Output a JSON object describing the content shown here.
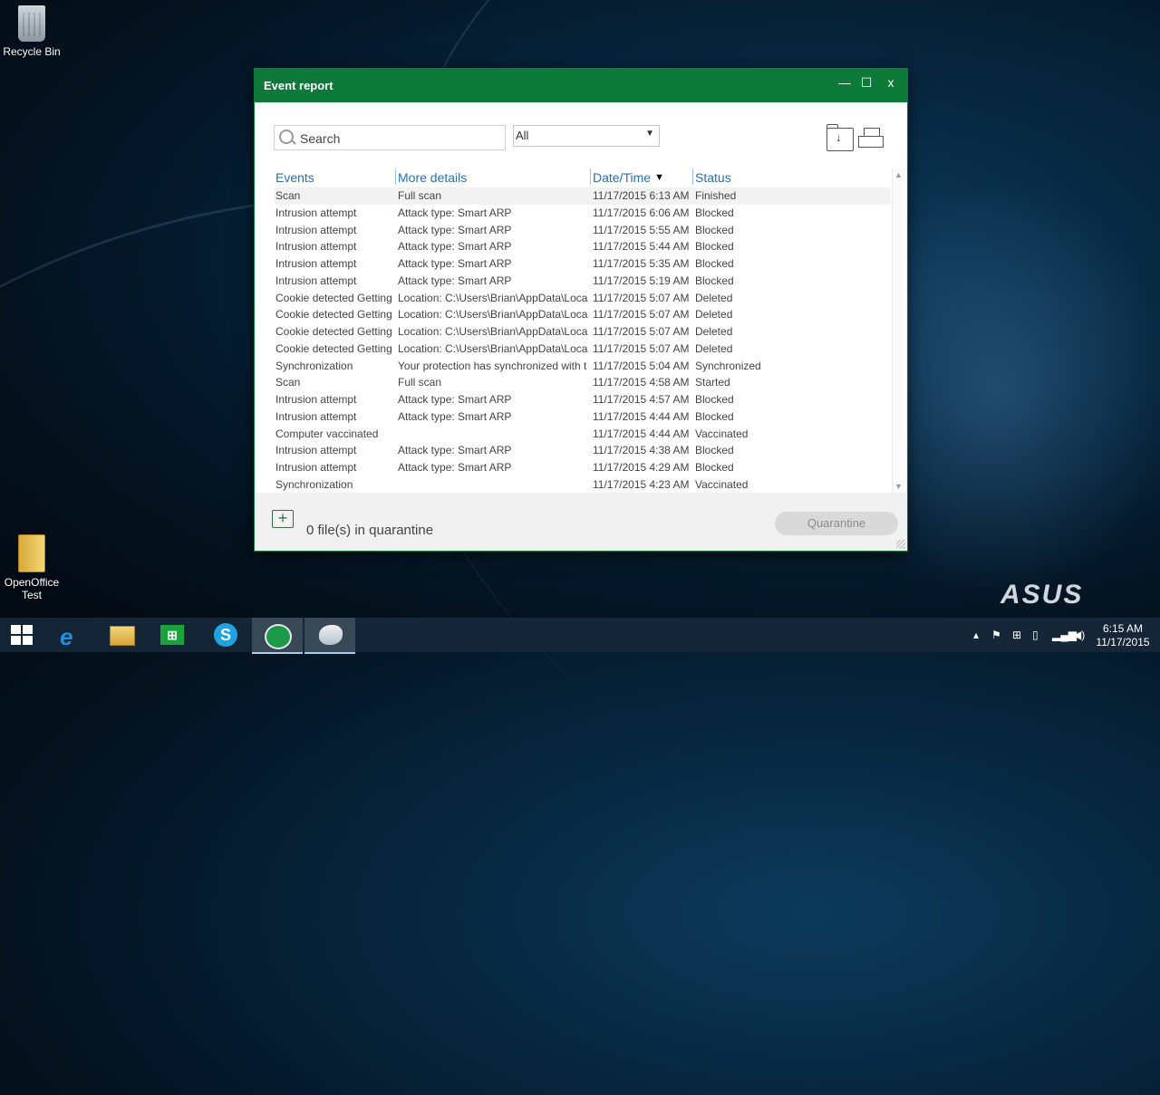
{
  "desktop": {
    "icons": [
      {
        "label": "Recycle Bin"
      },
      {
        "label": "OpenOffice Test"
      }
    ],
    "brand": "ASUS"
  },
  "window": {
    "title": "Event report",
    "controls": {
      "minimize": "—",
      "maximize": "☐",
      "close": "x"
    }
  },
  "toolbar": {
    "search_placeholder": "Search",
    "filter_value": "All"
  },
  "table": {
    "columns": [
      "Events",
      "More details",
      "Date/Time",
      "Status"
    ],
    "rows": [
      {
        "event": "Scan",
        "details": "Full scan",
        "datetime": "11/17/2015 6:13 AM",
        "status": "Finished"
      },
      {
        "event": "Intrusion attempt",
        "details": "Attack type: Smart ARP",
        "datetime": "11/17/2015 6:06 AM",
        "status": "Blocked"
      },
      {
        "event": "Intrusion attempt",
        "details": "Attack type: Smart ARP",
        "datetime": "11/17/2015 5:55 AM",
        "status": "Blocked"
      },
      {
        "event": "Intrusion attempt",
        "details": "Attack type: Smart ARP",
        "datetime": "11/17/2015 5:44 AM",
        "status": "Blocked"
      },
      {
        "event": "Intrusion attempt",
        "details": "Attack type: Smart ARP",
        "datetime": "11/17/2015 5:35 AM",
        "status": "Blocked"
      },
      {
        "event": "Intrusion attempt",
        "details": "Attack type: Smart ARP",
        "datetime": "11/17/2015 5:19 AM",
        "status": "Blocked"
      },
      {
        "event": "Cookie detected Getting",
        "details": "Location: C:\\Users\\Brian\\AppData\\Loca",
        "datetime": "11/17/2015 5:07 AM",
        "status": "Deleted"
      },
      {
        "event": "Cookie detected Getting",
        "details": "Location: C:\\Users\\Brian\\AppData\\Loca",
        "datetime": "11/17/2015 5:07 AM",
        "status": "Deleted"
      },
      {
        "event": "Cookie detected Getting",
        "details": "Location: C:\\Users\\Brian\\AppData\\Loca",
        "datetime": "11/17/2015 5:07 AM",
        "status": "Deleted"
      },
      {
        "event": "Cookie detected Getting",
        "details": "Location: C:\\Users\\Brian\\AppData\\Loca",
        "datetime": "11/17/2015 5:07 AM",
        "status": "Deleted"
      },
      {
        "event": "Synchronization",
        "details": "Your protection has synchronized with t",
        "datetime": "11/17/2015 5:04 AM",
        "status": "Synchronized"
      },
      {
        "event": "Scan",
        "details": "Full scan",
        "datetime": "11/17/2015 4:58 AM",
        "status": "Started"
      },
      {
        "event": "Intrusion attempt",
        "details": "Attack type: Smart ARP",
        "datetime": "11/17/2015 4:57 AM",
        "status": "Blocked"
      },
      {
        "event": "Intrusion attempt",
        "details": "Attack type: Smart ARP",
        "datetime": "11/17/2015 4:44 AM",
        "status": "Blocked"
      },
      {
        "event": "Computer vaccinated",
        "details": "",
        "datetime": "11/17/2015 4:44 AM",
        "status": "Vaccinated"
      },
      {
        "event": "Intrusion attempt",
        "details": "Attack type: Smart ARP",
        "datetime": "11/17/2015 4:38 AM",
        "status": "Blocked"
      },
      {
        "event": "Intrusion attempt",
        "details": "Attack type: Smart ARP",
        "datetime": "11/17/2015 4:29 AM",
        "status": "Blocked"
      },
      {
        "event": "Synchronization",
        "details": "",
        "datetime": "11/17/2015 4:23 AM",
        "status": "Vaccinated"
      }
    ]
  },
  "footer": {
    "quarantine_text": "0 file(s) in quarantine",
    "quarantine_button": "Quarantine"
  },
  "taskbar": {
    "clock_time": "6:15 AM",
    "clock_date": "11/17/2015"
  },
  "colors": {
    "title_bar": "#0d7a3a",
    "header_link": "#2a6fb0"
  }
}
